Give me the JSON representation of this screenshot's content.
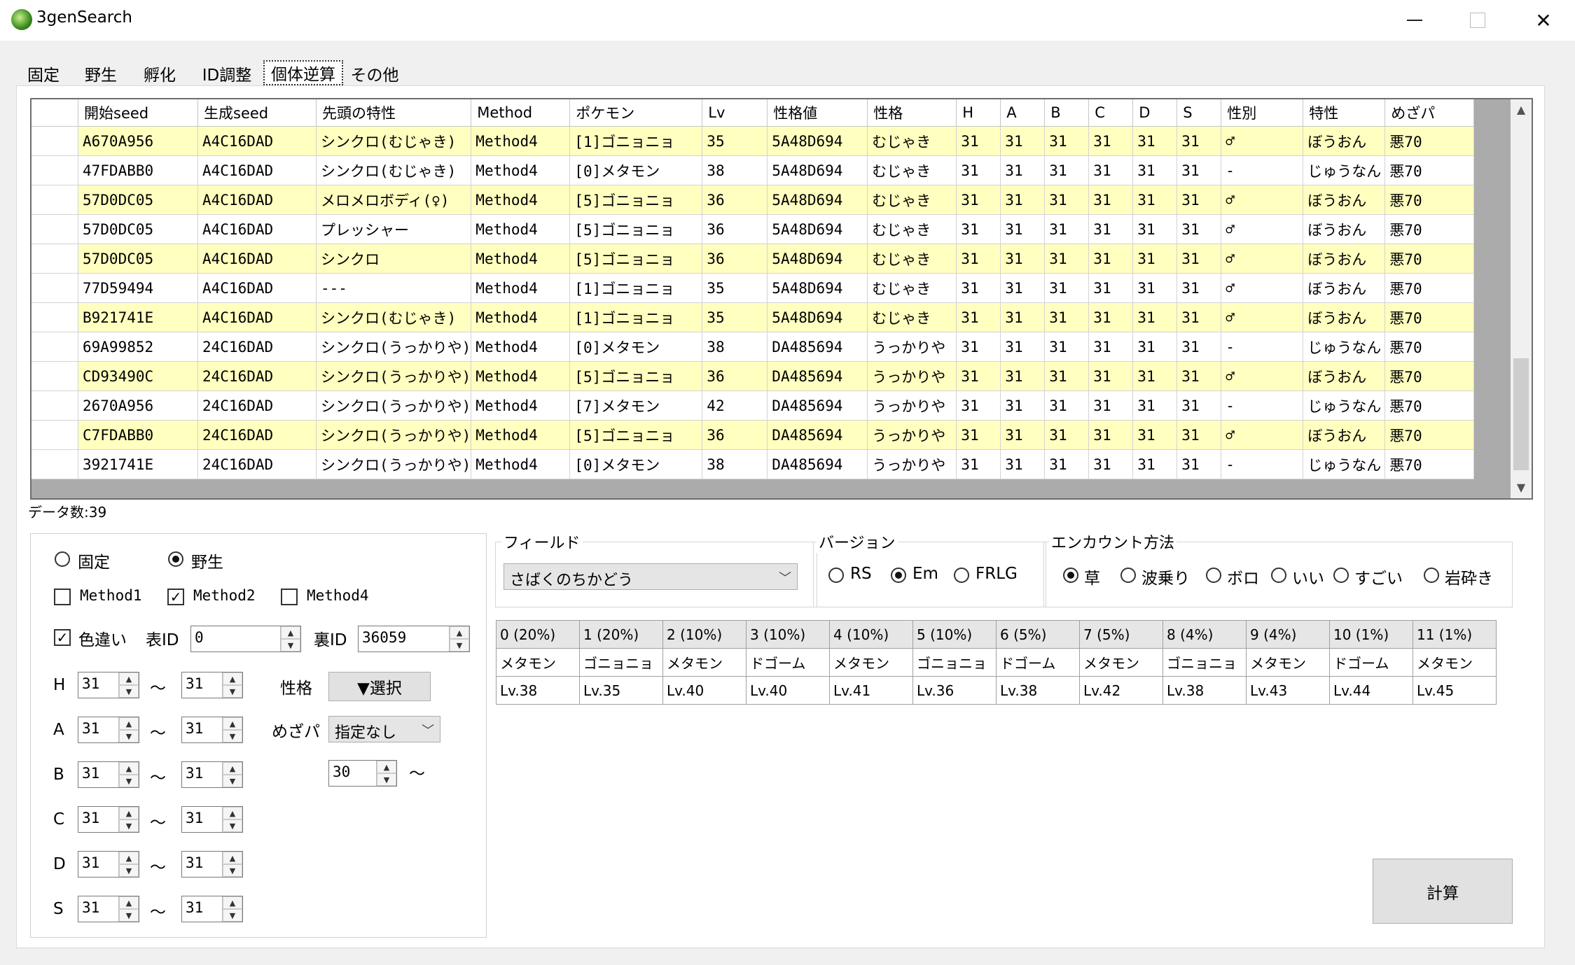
{
  "window": {
    "title": "3genSearch",
    "min": "—",
    "max": "",
    "close": "✕"
  },
  "tabs": [
    "固定",
    "野生",
    "孵化",
    "ID調整",
    "個体逆算",
    "その他"
  ],
  "selected_tab": 4,
  "results": {
    "columns": [
      "開始seed",
      "生成seed",
      "先頭の特性",
      "Method",
      "ポケモン",
      "Lv",
      "性格値",
      "性格",
      "H",
      "A",
      "B",
      "C",
      "D",
      "S",
      "性別",
      "特性",
      "めざパ"
    ],
    "rows": [
      [
        "A670A956",
        "A4C16DAD",
        "シンクロ(むじゃき)",
        "Method4",
        "[1]ゴニョニョ",
        "35",
        "5A48D694",
        "むじゃき",
        "31",
        "31",
        "31",
        "31",
        "31",
        "31",
        "♂",
        "ぼうおん",
        "悪70"
      ],
      [
        "47FDABB0",
        "A4C16DAD",
        "シンクロ(むじゃき)",
        "Method4",
        "[0]メタモン",
        "38",
        "5A48D694",
        "むじゃき",
        "31",
        "31",
        "31",
        "31",
        "31",
        "31",
        "-",
        "じゅうなん",
        "悪70"
      ],
      [
        "57D0DC05",
        "A4C16DAD",
        "メロメロボディ(♀)",
        "Method4",
        "[5]ゴニョニョ",
        "36",
        "5A48D694",
        "むじゃき",
        "31",
        "31",
        "31",
        "31",
        "31",
        "31",
        "♂",
        "ぼうおん",
        "悪70"
      ],
      [
        "57D0DC05",
        "A4C16DAD",
        "プレッシャー",
        "Method4",
        "[5]ゴニョニョ",
        "36",
        "5A48D694",
        "むじゃき",
        "31",
        "31",
        "31",
        "31",
        "31",
        "31",
        "♂",
        "ぼうおん",
        "悪70"
      ],
      [
        "57D0DC05",
        "A4C16DAD",
        "シンクロ",
        "Method4",
        "[5]ゴニョニョ",
        "36",
        "5A48D694",
        "むじゃき",
        "31",
        "31",
        "31",
        "31",
        "31",
        "31",
        "♂",
        "ぼうおん",
        "悪70"
      ],
      [
        "77D59494",
        "A4C16DAD",
        "---",
        "Method4",
        "[1]ゴニョニョ",
        "35",
        "5A48D694",
        "むじゃき",
        "31",
        "31",
        "31",
        "31",
        "31",
        "31",
        "♂",
        "ぼうおん",
        "悪70"
      ],
      [
        "B921741E",
        "A4C16DAD",
        "シンクロ(むじゃき)",
        "Method4",
        "[1]ゴニョニョ",
        "35",
        "5A48D694",
        "むじゃき",
        "31",
        "31",
        "31",
        "31",
        "31",
        "31",
        "♂",
        "ぼうおん",
        "悪70"
      ],
      [
        "69A99852",
        "24C16DAD",
        "シンクロ(うっかりや)",
        "Method4",
        "[0]メタモン",
        "38",
        "DA485694",
        "うっかりや",
        "31",
        "31",
        "31",
        "31",
        "31",
        "31",
        "-",
        "じゅうなん",
        "悪70"
      ],
      [
        "CD93490C",
        "24C16DAD",
        "シンクロ(うっかりや)",
        "Method4",
        "[5]ゴニョニョ",
        "36",
        "DA485694",
        "うっかりや",
        "31",
        "31",
        "31",
        "31",
        "31",
        "31",
        "♂",
        "ぼうおん",
        "悪70"
      ],
      [
        "2670A956",
        "24C16DAD",
        "シンクロ(うっかりや)",
        "Method4",
        "[7]メタモン",
        "42",
        "DA485694",
        "うっかりや",
        "31",
        "31",
        "31",
        "31",
        "31",
        "31",
        "-",
        "じゅうなん",
        "悪70"
      ],
      [
        "C7FDABB0",
        "24C16DAD",
        "シンクロ(うっかりや)",
        "Method4",
        "[5]ゴニョニョ",
        "36",
        "DA485694",
        "うっかりや",
        "31",
        "31",
        "31",
        "31",
        "31",
        "31",
        "♂",
        "ぼうおん",
        "悪70"
      ],
      [
        "3921741E",
        "24C16DAD",
        "シンクロ(うっかりや)",
        "Method4",
        "[0]メタモン",
        "38",
        "DA485694",
        "うっかりや",
        "31",
        "31",
        "31",
        "31",
        "31",
        "31",
        "-",
        "じゅうなん",
        "悪70"
      ]
    ],
    "count_label": "データ数:39"
  },
  "mode": {
    "fixed": "固定",
    "wild": "野生",
    "selected": "wild"
  },
  "methods": [
    {
      "label": "Method1",
      "checked": false
    },
    {
      "label": "Method2",
      "checked": true
    },
    {
      "label": "Method4",
      "checked": false
    }
  ],
  "shiny": {
    "label": "色違い",
    "checked": true,
    "omote_label": "表ID",
    "omote_value": "0",
    "ura_label": "裏ID",
    "ura_value": "36059"
  },
  "ivs": [
    {
      "stat": "H",
      "min": "31",
      "max": "31"
    },
    {
      "stat": "A",
      "min": "31",
      "max": "31"
    },
    {
      "stat": "B",
      "min": "31",
      "max": "31"
    },
    {
      "stat": "C",
      "min": "31",
      "max": "31"
    },
    {
      "stat": "D",
      "min": "31",
      "max": "31"
    },
    {
      "stat": "S",
      "min": "31",
      "max": "31"
    }
  ],
  "tilde": "〜",
  "nature": {
    "label": "性格",
    "button": "▼選択"
  },
  "hidden_power": {
    "label": "めざパ",
    "value": "指定なし",
    "power": "30",
    "power_tilde": "〜"
  },
  "field": {
    "title": "フィールド",
    "value": "さばくのちかどう"
  },
  "version": {
    "title": "バージョン",
    "options": [
      "RS",
      "Em",
      "FRLG"
    ],
    "selected": 1
  },
  "encounter": {
    "title": "エンカウント方法",
    "options": [
      "草",
      "波乗り",
      "ボロ",
      "いい",
      "すごい",
      "岩砕き"
    ],
    "selected": 0
  },
  "slots": {
    "headers": [
      "0 (20%)",
      "1 (20%)",
      "2 (10%)",
      "3 (10%)",
      "4 (10%)",
      "5 (10%)",
      "6 (5%)",
      "7 (5%)",
      "8 (4%)",
      "9 (4%)",
      "10 (1%)",
      "11 (1%)"
    ],
    "pokemon": [
      "メタモン",
      "ゴニョニョ",
      "メタモン",
      "ドゴーム",
      "メタモン",
      "ゴニョニョ",
      "ドゴーム",
      "メタモン",
      "ゴニョニョ",
      "メタモン",
      "ドゴーム",
      "メタモン"
    ],
    "levels": [
      "Lv.38",
      "Lv.35",
      "Lv.40",
      "Lv.40",
      "Lv.41",
      "Lv.36",
      "Lv.38",
      "Lv.42",
      "Lv.38",
      "Lv.43",
      "Lv.44",
      "Lv.45"
    ]
  },
  "calc_button": "計算",
  "colors": {
    "row_highlight": "#ffffc0",
    "grid_bg": "#ababab"
  }
}
